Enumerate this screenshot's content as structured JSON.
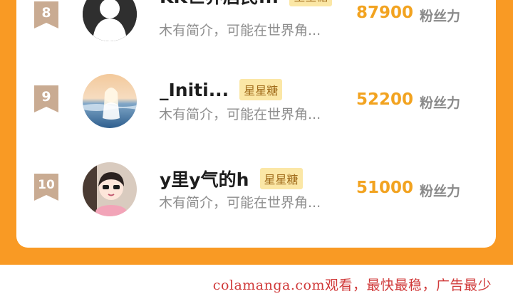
{
  "ranking": {
    "rows": [
      {
        "rank": "8",
        "name": "KK世界居民...",
        "tag": "星星糖",
        "bio": "木有简介，可能在世界角...",
        "count": "87900",
        "unit": "粉丝力",
        "badge_color": "#c9ab92",
        "avatar": "default-person-avatar"
      },
      {
        "rank": "9",
        "name": "_Initi...",
        "tag": "星星糖",
        "bio": "木有简介，可能在世界角...",
        "count": "52200",
        "unit": "粉丝力",
        "badge_color": "#c9ab92",
        "avatar": "seaside-girl-avatar"
      },
      {
        "rank": "10",
        "name": "y里y气的h",
        "tag": "星星糖",
        "bio": "木有简介，可能在世界角...",
        "count": "51000",
        "unit": "粉丝力",
        "badge_color": "#c9ab92",
        "avatar": "cartoon-girl-avatar"
      }
    ]
  },
  "watermark": "colamanga.com观看，最快最稳，广告最少",
  "colors": {
    "page_orange": "#f99a24",
    "count_gold": "#f2a320",
    "tag_bg": "#fbe7a6",
    "watermark_red": "#d03a3a"
  }
}
